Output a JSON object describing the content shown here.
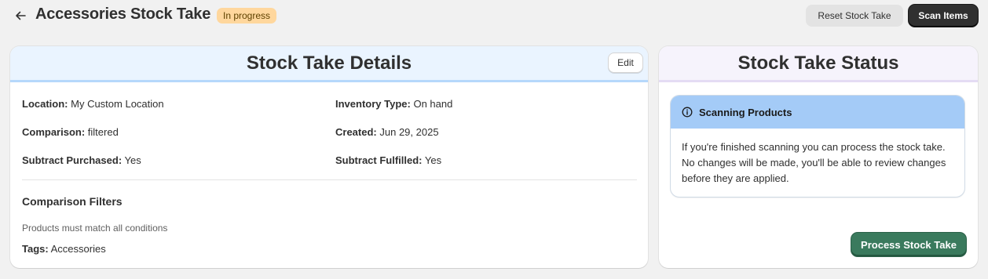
{
  "header": {
    "title": "Accessories Stock Take",
    "status": "In progress",
    "reset_label": "Reset Stock Take",
    "scan_label": "Scan Items"
  },
  "details": {
    "title": "Stock Take Details",
    "edit_label": "Edit",
    "fields": [
      {
        "label": "Location:",
        "value": "My Custom Location"
      },
      {
        "label": "Inventory Type:",
        "value": "On hand"
      },
      {
        "label": "Comparison:",
        "value": "filtered"
      },
      {
        "label": "Created:",
        "value": "Jun 29, 2025"
      },
      {
        "label": "Subtract Purchased:",
        "value": "Yes"
      },
      {
        "label": "Subtract Fulfilled:",
        "value": "Yes"
      }
    ],
    "filters": {
      "title": "Comparison Filters",
      "subtext": "Products must match all conditions",
      "tags_label": "Tags:",
      "tags_value": "Accessories"
    }
  },
  "status": {
    "title": "Stock Take Status",
    "banner_title": "Scanning Products",
    "banner_body": "If you're finished scanning you can process the stock take. No changes will be made, you'll be able to review changes before they are applied.",
    "process_label": "Process Stock Take"
  },
  "colors": {
    "badge_bg": "#ffd79d",
    "primary": "#303030",
    "success": "#3a7a5d",
    "info": "#a4cbf7"
  },
  "icons": {
    "back": "arrow-left-icon",
    "info": "info-circle-icon"
  }
}
